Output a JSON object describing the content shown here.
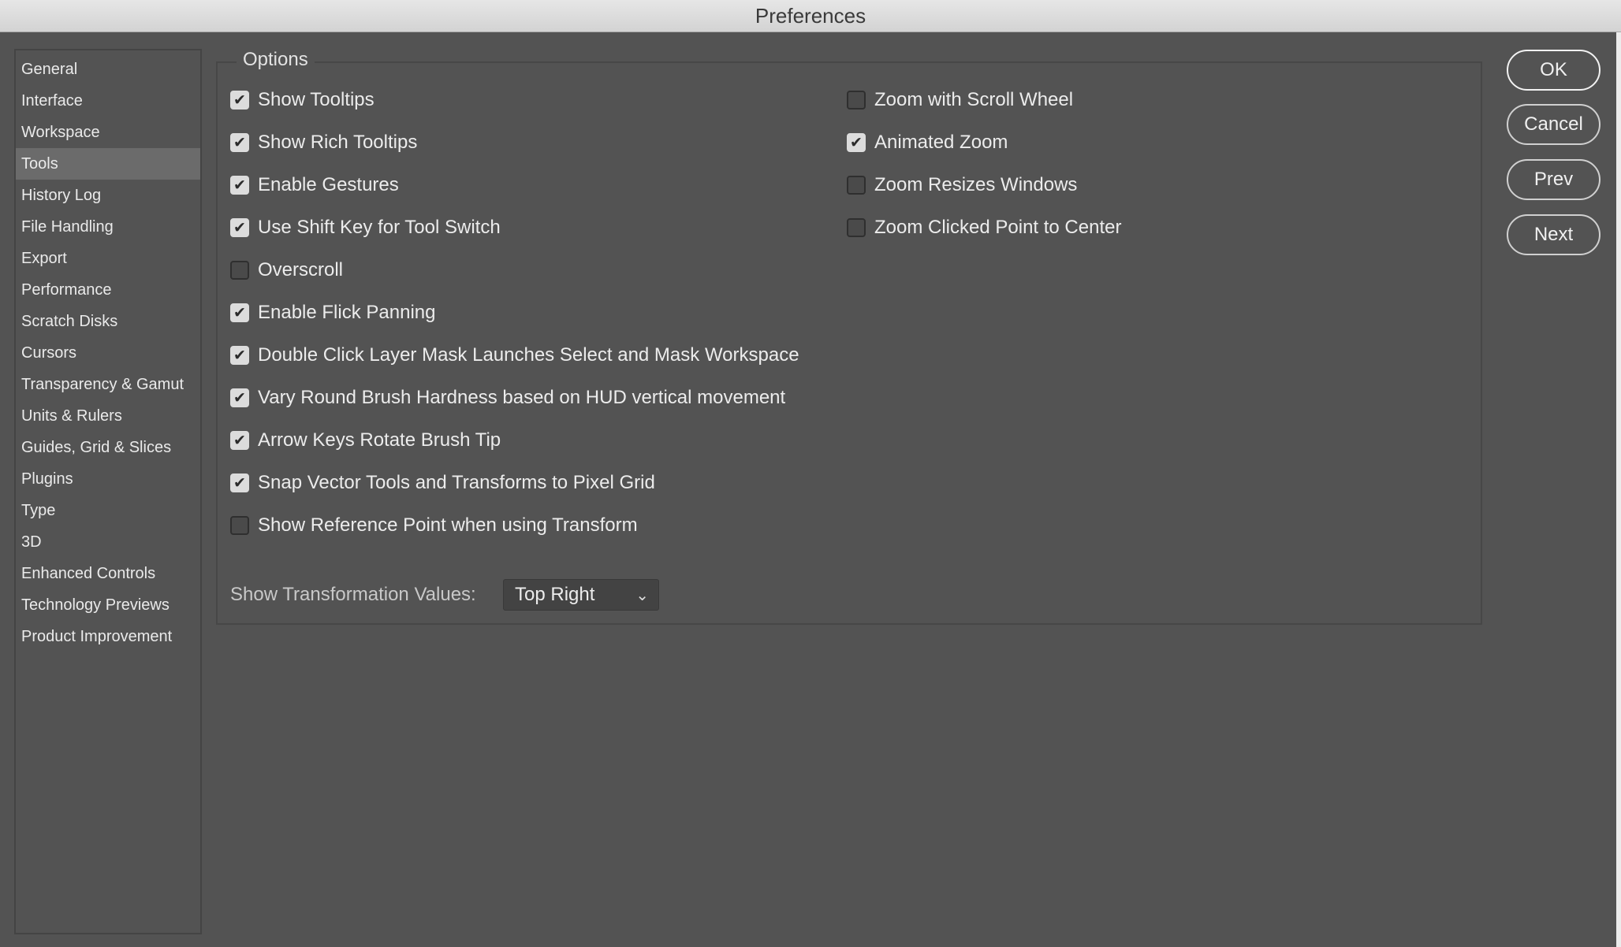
{
  "window": {
    "title": "Preferences"
  },
  "sidebar": {
    "items": [
      {
        "label": "General"
      },
      {
        "label": "Interface"
      },
      {
        "label": "Workspace"
      },
      {
        "label": "Tools",
        "active": true
      },
      {
        "label": "History Log"
      },
      {
        "label": "File Handling"
      },
      {
        "label": "Export"
      },
      {
        "label": "Performance"
      },
      {
        "label": "Scratch Disks"
      },
      {
        "label": "Cursors"
      },
      {
        "label": "Transparency & Gamut"
      },
      {
        "label": "Units & Rulers"
      },
      {
        "label": "Guides, Grid & Slices"
      },
      {
        "label": "Plugins"
      },
      {
        "label": "Type"
      },
      {
        "label": "3D"
      },
      {
        "label": "Enhanced Controls"
      },
      {
        "label": "Technology Previews"
      },
      {
        "label": "Product Improvement"
      }
    ]
  },
  "options": {
    "legend": "Options",
    "left": [
      {
        "label": "Show Tooltips",
        "checked": true
      },
      {
        "label": "Show Rich Tooltips",
        "checked": true
      },
      {
        "label": "Enable Gestures",
        "checked": true
      },
      {
        "label": "Use Shift Key for Tool Switch",
        "checked": true
      },
      {
        "label": "Overscroll",
        "checked": false
      },
      {
        "label": "Enable Flick Panning",
        "checked": true
      },
      {
        "label": "Double Click Layer Mask Launches Select and Mask Workspace",
        "checked": true
      },
      {
        "label": "Vary Round Brush Hardness based on HUD vertical movement",
        "checked": true
      },
      {
        "label": "Arrow Keys Rotate Brush Tip",
        "checked": true
      },
      {
        "label": "Snap Vector Tools and Transforms to Pixel Grid",
        "checked": true
      },
      {
        "label": "Show Reference Point when using Transform",
        "checked": false
      }
    ],
    "right": [
      {
        "label": "Zoom with Scroll Wheel",
        "checked": false
      },
      {
        "label": "Animated Zoom",
        "checked": true
      },
      {
        "label": "Zoom Resizes Windows",
        "checked": false
      },
      {
        "label": "Zoom Clicked Point to Center",
        "checked": false
      }
    ],
    "transformation_values": {
      "label": "Show Transformation Values:",
      "selected": "Top Right"
    }
  },
  "buttons": {
    "ok": "OK",
    "cancel": "Cancel",
    "prev": "Prev",
    "next": "Next"
  },
  "icons": {
    "check": "checkmark-icon",
    "dropdown": "chevron-down-icon"
  }
}
